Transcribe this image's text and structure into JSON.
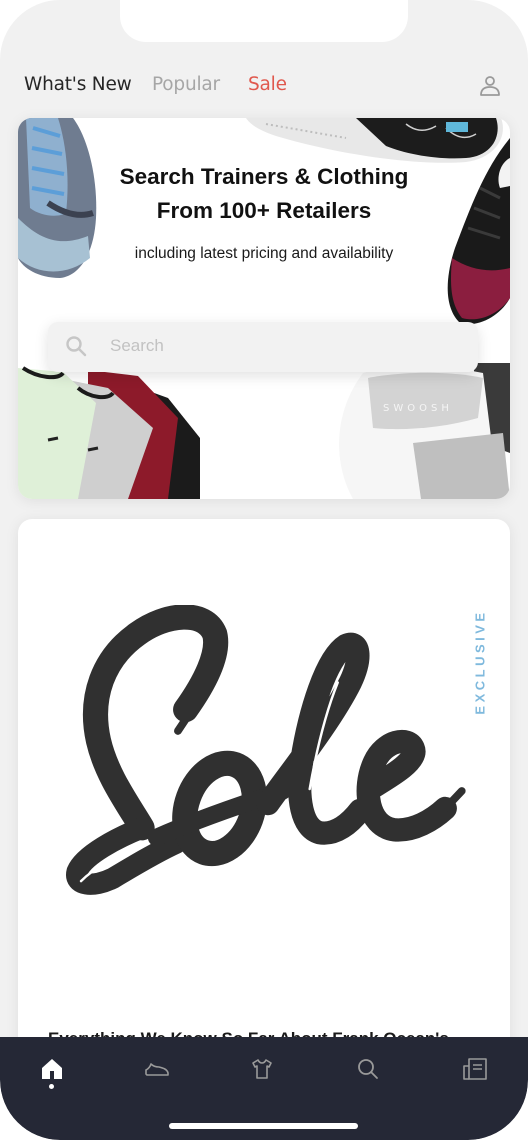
{
  "header": {
    "tabs": [
      {
        "label": "What's New",
        "active": true
      },
      {
        "label": "Popular",
        "active": false
      },
      {
        "label": "Sale",
        "active": false,
        "accent": "#e0584d"
      }
    ],
    "profile_icon": "user-icon"
  },
  "hero": {
    "title_line1": "Search Trainers & Clothing",
    "title_line2": "From 100+ Retailers",
    "subtitle": "including latest pricing and availability",
    "search": {
      "placeholder": "Search",
      "icon": "search-icon"
    },
    "images": [
      "sneaker-blue-yeezy",
      "sneaker-white-air-max",
      "sneaker-black-red-jordan",
      "sweatshirts-stack",
      "swoosh-hoodies"
    ]
  },
  "feature_card": {
    "badge": "EXCLUSIVE",
    "badge_color": "#7fb9dd",
    "logo_text": "Sole",
    "article_title": "Everything We Know So Far About Frank Ocean's"
  },
  "tabbar": {
    "items": [
      {
        "name": "home",
        "icon": "home-icon",
        "active": true
      },
      {
        "name": "sneakers",
        "icon": "sneaker-icon",
        "active": false
      },
      {
        "name": "clothing",
        "icon": "tshirt-icon",
        "active": false
      },
      {
        "name": "search",
        "icon": "search-icon",
        "active": false
      },
      {
        "name": "news",
        "icon": "newspaper-icon",
        "active": false
      }
    ],
    "background": "#252836"
  }
}
